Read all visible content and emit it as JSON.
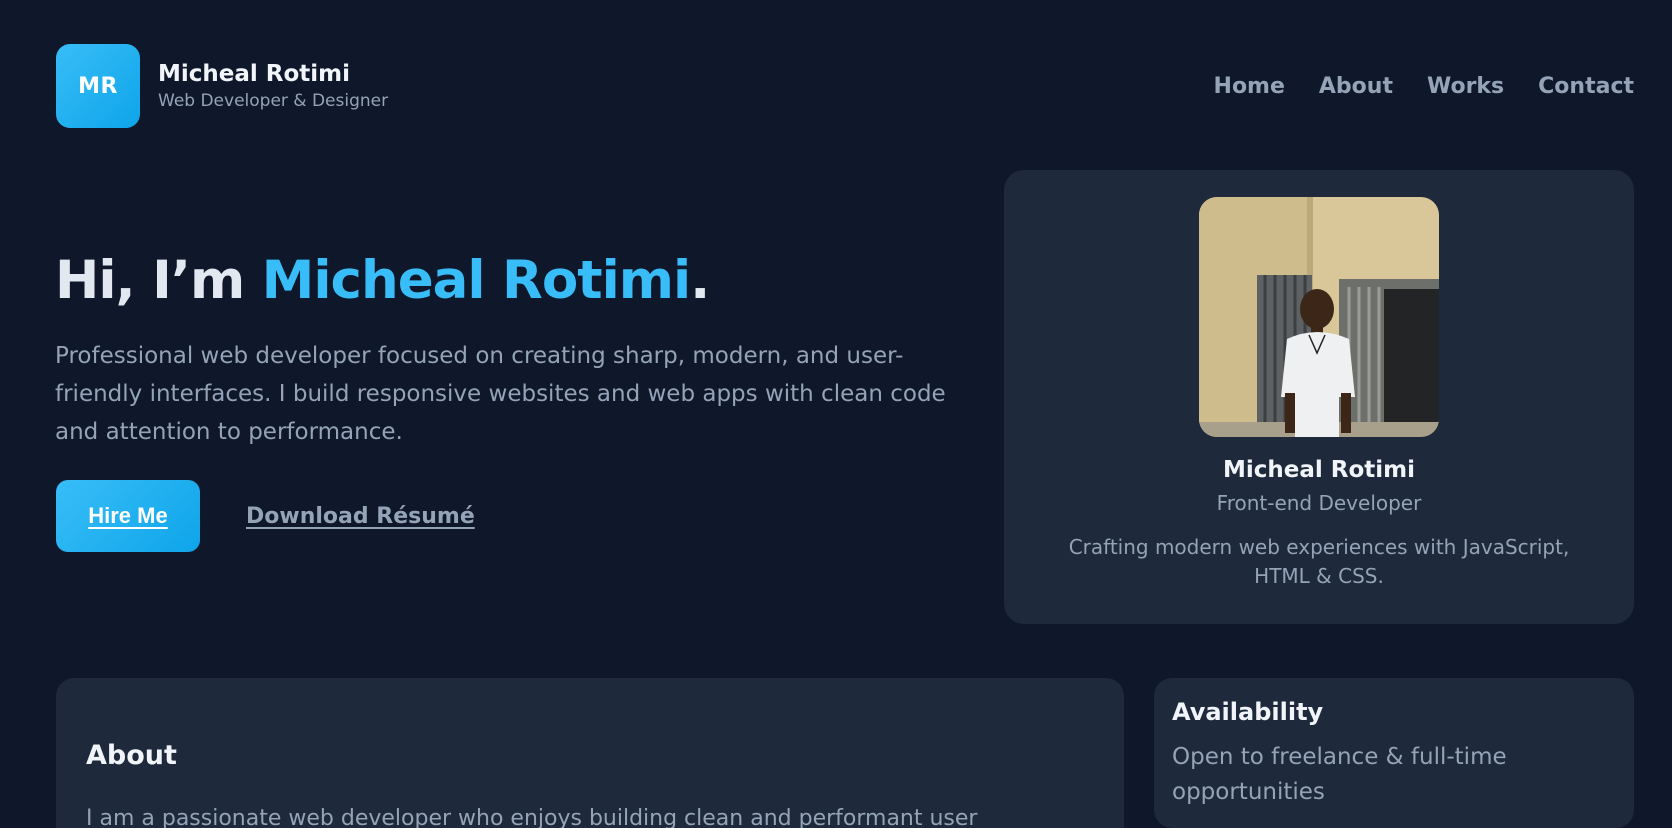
{
  "header": {
    "logo_initials": "MR",
    "brand_name": "Micheal Rotimi",
    "brand_tagline": "Web Developer & Designer",
    "nav": [
      {
        "label": "Home"
      },
      {
        "label": "About"
      },
      {
        "label": "Works"
      },
      {
        "label": "Contact"
      }
    ]
  },
  "hero": {
    "title_prefix": "Hi, I’m ",
    "title_name": "Micheal Rotimi",
    "title_suffix": ".",
    "description": "Professional web developer focused on creating sharp, modern, and user-friendly interfaces. I build responsive websites and web apps with clean code and attention to performance.",
    "primary_button": "Hire Me",
    "secondary_link": "Download Résumé"
  },
  "profile_card": {
    "name": "Micheal Rotimi",
    "role": "Front-end Developer",
    "description": "Crafting modern web experiences with JavaScript, HTML & CSS."
  },
  "about": {
    "title": "About",
    "text": "I am a passionate web developer who enjoys building clean and performant user"
  },
  "availability": {
    "title": "Availability",
    "text": "Open to freelance & full-time opportunities"
  },
  "colors": {
    "background": "#0f172a",
    "card": "#1e293b",
    "accent": "#38bdf8",
    "muted_text": "#94a3b8"
  }
}
